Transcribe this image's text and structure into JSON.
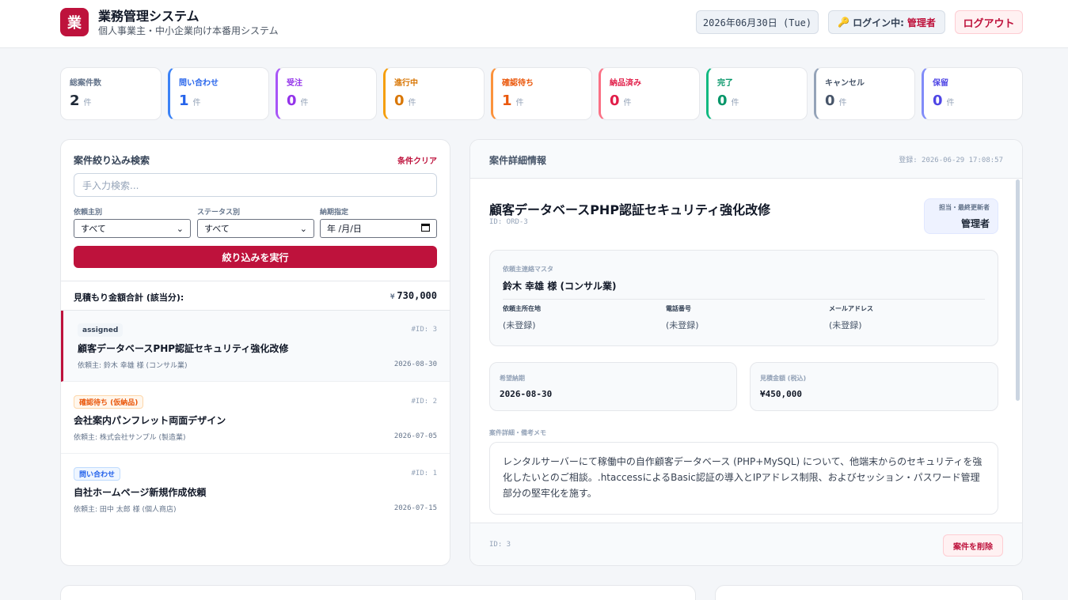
{
  "header": {
    "logo_char": "業",
    "title": "業務管理システム",
    "subtitle": "個人事業主・中小企業向け本番用システム",
    "date": "2026年06月30日 (Tue)",
    "login_prefix": "ログイン中:",
    "login_user": "管理者",
    "logout": "ログアウト"
  },
  "stats": [
    {
      "label": "総案件数",
      "value": "2",
      "unit": "件",
      "color": "#1f2937",
      "accent": "#e5e7eb"
    },
    {
      "label": "問い合わせ",
      "value": "1",
      "unit": "件",
      "color": "#2563eb",
      "accent": "#3b82f6"
    },
    {
      "label": "受注",
      "value": "0",
      "unit": "件",
      "color": "#9333ea",
      "accent": "#a855f7"
    },
    {
      "label": "進行中",
      "value": "0",
      "unit": "件",
      "color": "#d97706",
      "accent": "#f59e0b"
    },
    {
      "label": "確認待ち",
      "value": "1",
      "unit": "件",
      "color": "#ea580c",
      "accent": "#fb923c"
    },
    {
      "label": "納品済み",
      "value": "0",
      "unit": "件",
      "color": "#e11d48",
      "accent": "#fb7185"
    },
    {
      "label": "完了",
      "value": "0",
      "unit": "件",
      "color": "#059669",
      "accent": "#10b981"
    },
    {
      "label": "キャンセル",
      "value": "0",
      "unit": "件",
      "color": "#475569",
      "accent": "#94a3b8"
    },
    {
      "label": "保留",
      "value": "0",
      "unit": "件",
      "color": "#4f46e5",
      "accent": "#818cf8"
    }
  ],
  "filter": {
    "title": "案件絞り込み検索",
    "clear": "条件クリア",
    "search_placeholder": "手入力検索...",
    "client_label": "依頼主別",
    "client_value": "すべて",
    "status_label": "ステータス別",
    "status_value": "すべて",
    "due_label": "納期指定",
    "due_value": "年 /月/日",
    "run": "絞り込みを実行",
    "sum_label": "見積もり金額合計 (該当分):",
    "sum_yen": "¥",
    "sum_value": "730,000"
  },
  "cases": [
    {
      "badge": "assigned",
      "badge_bg": "#f1f5f9",
      "badge_color": "#334155",
      "id": "#ID: 3",
      "title": "顧客データベースPHP認証セキュリティ強化改修",
      "client": "依頼主: 鈴木 幸雄 様 (コンサル業)",
      "date": "2026-08-30"
    },
    {
      "badge": "確認待ち (仮納品)",
      "badge_bg": "#fff7ed",
      "badge_color": "#ea580c",
      "id": "#ID: 2",
      "title": "会社案内パンフレット両面デザイン",
      "client": "依頼主: 株式会社サンプル (製造業)",
      "date": "2026-07-05"
    },
    {
      "badge": "問い合わせ",
      "badge_bg": "#eff6ff",
      "badge_color": "#2563eb",
      "id": "#ID: 1",
      "title": "自社ホームページ新規作成依頼",
      "client": "依頼主: 田中 太郎 様 (個人商店)",
      "date": "2026-07-15"
    }
  ],
  "detail": {
    "head_title": "案件詳細情報",
    "registered": "登録: 2026-06-29 17:08:57",
    "title": "顧客データベースPHP認証セキュリティ強化改修",
    "sub_id": "ID: ORD-3",
    "owner_label": "担当・最終更新者",
    "owner_name": "管理者",
    "contact_label": "依頼主連絡マスタ",
    "contact_name": "鈴木 幸雄 様 (コンサル業)",
    "address_label": "依頼主所在地",
    "address_value": "(未登録)",
    "phone_label": "電話番号",
    "phone_value": "(未登録)",
    "email_label": "メールアドレス",
    "email_value": "(未登録)",
    "due_label": "希望納期",
    "due_value": "2026-08-30",
    "amount_label": "見積金額 (税込)",
    "amount_value": "¥450,000",
    "memo_label": "案件詳細・備考メモ",
    "memo": "レンタルサーバーにて稼働中の自作顧客データベース (PHP+MySQL) について、他端末からのセキュリティを強化したいとのご相談。.htaccessによるBasic認証の導入とIPアドレス制限、およびセッション・パスワード管理部分の堅牢化を施す。",
    "footer_id": "ID: 3",
    "delete": "案件を削除"
  }
}
